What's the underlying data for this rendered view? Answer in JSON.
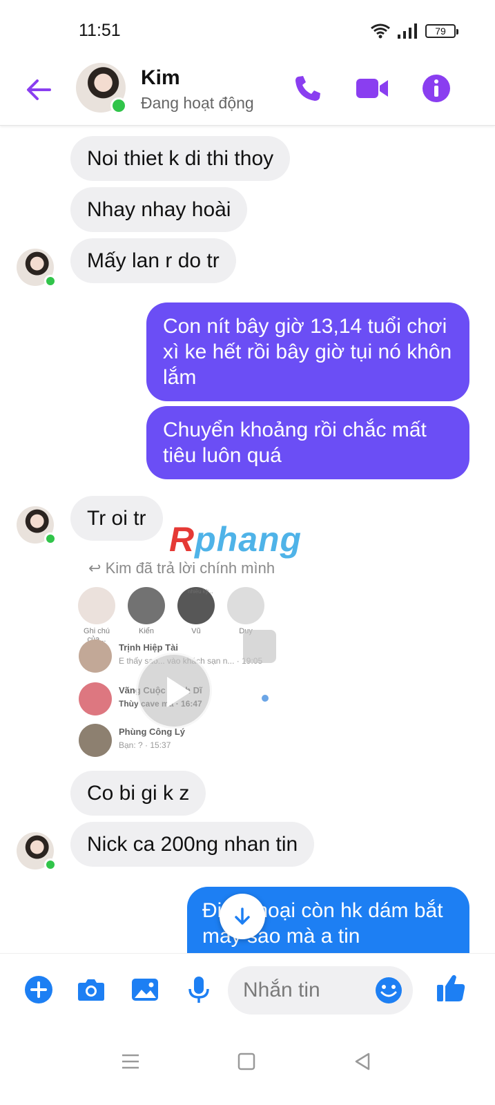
{
  "status_bar": {
    "time": "11:51",
    "battery": "79"
  },
  "header": {
    "name": "Kim",
    "status": "Đang hoạt động"
  },
  "messages": [
    {
      "text": "Noi thiet k di thi thoy"
    },
    {
      "text": "Nhay nhay hoài"
    },
    {
      "text": "Mấy lan r do tr"
    },
    {
      "text": "Con nít bây giờ 13,14 tuổi chơi xì ke hết rồi bây giờ tụi nó khôn lắm"
    },
    {
      "text": "Chuyển khoảng rồi chắc mất tiêu luôn quá"
    },
    {
      "text": "Tr oi tr"
    },
    {
      "text": "Co bi gi k z"
    },
    {
      "text": "Nick ca 200ng nhan tin"
    },
    {
      "text": "Điện thoại còn hk dám bắt máy sao mà a tin"
    }
  ],
  "reply_note": "Kim đã trả lời chính mình",
  "watermark": {
    "r": "R",
    "rest": "phang"
  },
  "preview": {
    "stories": [
      "Ghi chú của...",
      "Kiển",
      "Vũ",
      "Duy"
    ],
    "story_note": "nhiều kỳ...",
    "rows": [
      {
        "name": "Trịnh Hiệp Tài",
        "msg": "E thấy sao... vào khách sạn n... · 19:05"
      },
      {
        "name": "Vãng Cuộc Hạnh Dĩ",
        "msg": "Thùy cave mà · 16:47"
      },
      {
        "name": "Phùng Công Lý",
        "msg": "Bạn: ? · 15:37"
      }
    ]
  },
  "composer": {
    "placeholder": "Nhắn tin"
  },
  "colors": {
    "accent": "#8a3ef0",
    "outgoing": "#6b4ef5",
    "outgoing_blue": "#1d7ff3",
    "incoming": "#efeff1",
    "online": "#31c44a"
  }
}
